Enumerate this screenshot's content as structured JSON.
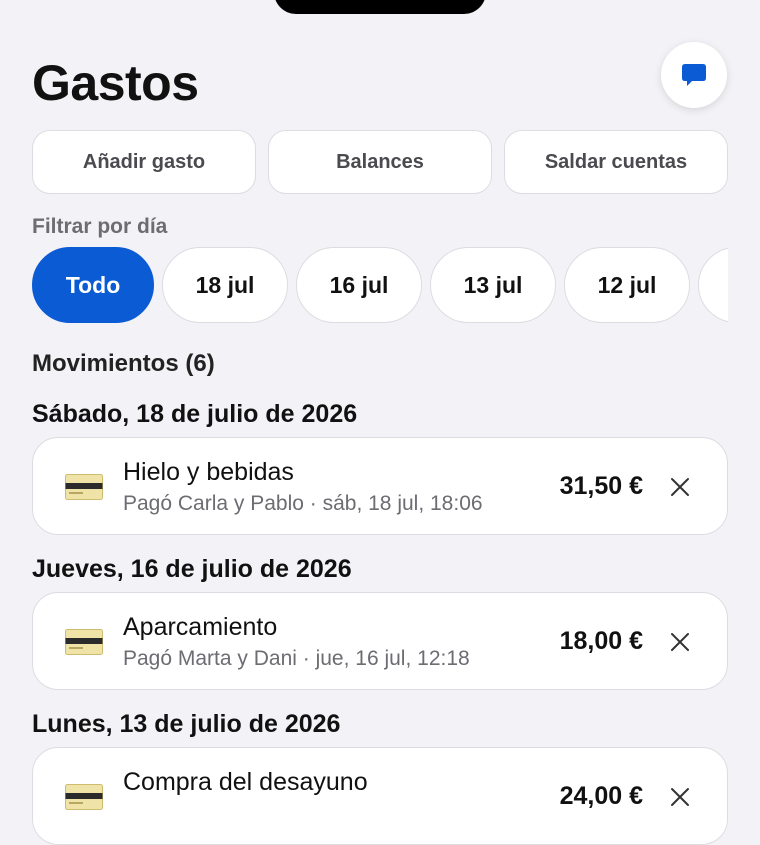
{
  "header": {
    "title": "Gastos",
    "chat_icon": "chat-bubble-icon",
    "accent_color": "#0a5bd4"
  },
  "actions": [
    {
      "label": "Añadir gasto"
    },
    {
      "label": "Balances"
    },
    {
      "label": "Saldar cuentas"
    }
  ],
  "filter": {
    "label": "Filtrar por día",
    "chips": [
      {
        "label": "Todo",
        "selected": true
      },
      {
        "label": "18 jul"
      },
      {
        "label": "16 jul"
      },
      {
        "label": "13 jul"
      },
      {
        "label": "12 jul"
      },
      {
        "label": ""
      }
    ]
  },
  "movements": {
    "title": "Movimientos (6)",
    "groups": [
      {
        "heading": "Sábado, 18 de julio de 2026",
        "items": [
          {
            "icon": "credit-card-icon",
            "name": "Hielo y bebidas",
            "subtitle": "Pagó Carla y Pablo · sáb, 18 jul, 18:06",
            "amount": "31,50 €"
          }
        ]
      },
      {
        "heading": "Jueves, 16 de julio de 2026",
        "items": [
          {
            "icon": "credit-card-icon",
            "name": "Aparcamiento",
            "subtitle": "Pagó Marta y Dani · jue, 16 jul, 12:18",
            "amount": "18,00 €"
          }
        ]
      },
      {
        "heading": "Lunes, 13 de julio de 2026",
        "items": [
          {
            "icon": "credit-card-icon",
            "name": "Compra del desayuno",
            "subtitle": "",
            "amount": "24,00 €"
          }
        ]
      }
    ]
  }
}
